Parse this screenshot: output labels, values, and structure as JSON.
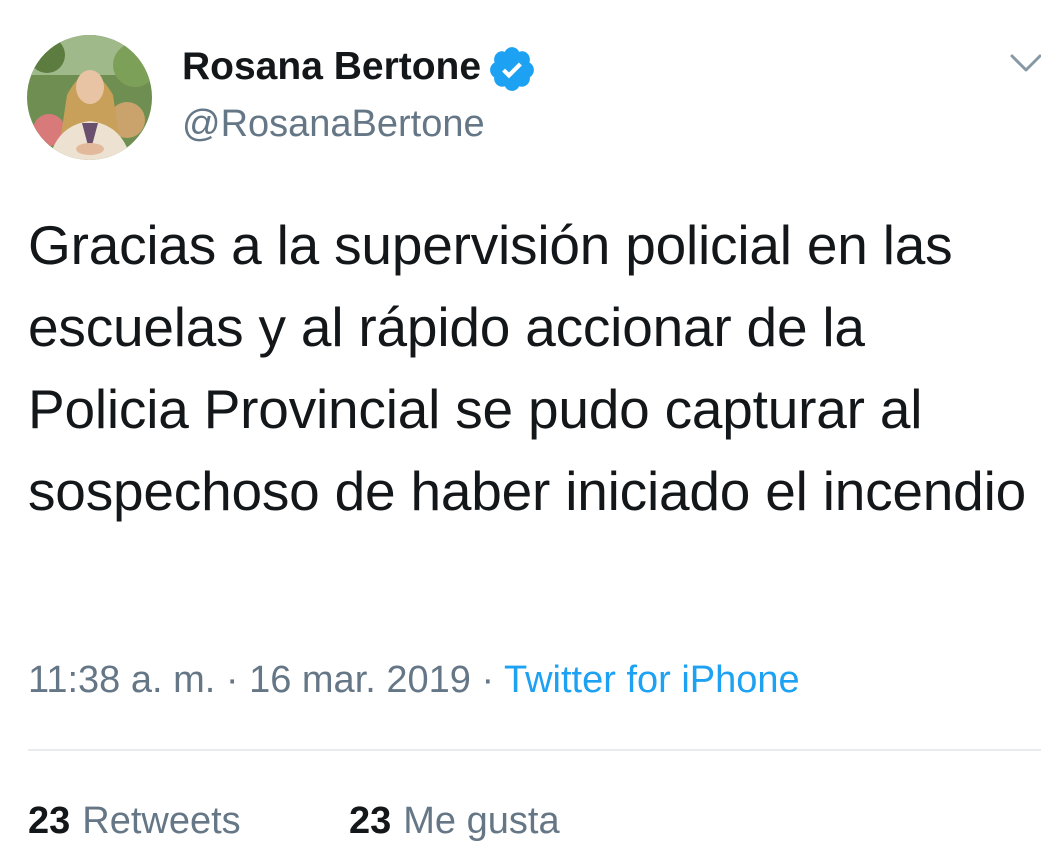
{
  "tweet": {
    "author": {
      "display_name": "Rosana Bertone",
      "handle": "@RosanaBertone",
      "verified_icon": "verified-badge-icon"
    },
    "menu_icon": "chevron-down-icon",
    "text": "Gracias a la supervisión policial en las escuelas y al rápido accionar de la Policia Provincial se pudo capturar al sospechoso de haber iniciado el incendio",
    "time": "11:38 a. m.",
    "date": "16 mar. 2019",
    "separator": "·",
    "source": "Twitter for iPhone",
    "stats": {
      "retweets": {
        "count": "23",
        "label": "Retweets"
      },
      "likes": {
        "count": "23",
        "label": "Me gusta"
      }
    }
  },
  "colors": {
    "text": "#14171a",
    "secondary": "#657786",
    "link": "#1da1f2",
    "divider": "#e6ecf0"
  }
}
